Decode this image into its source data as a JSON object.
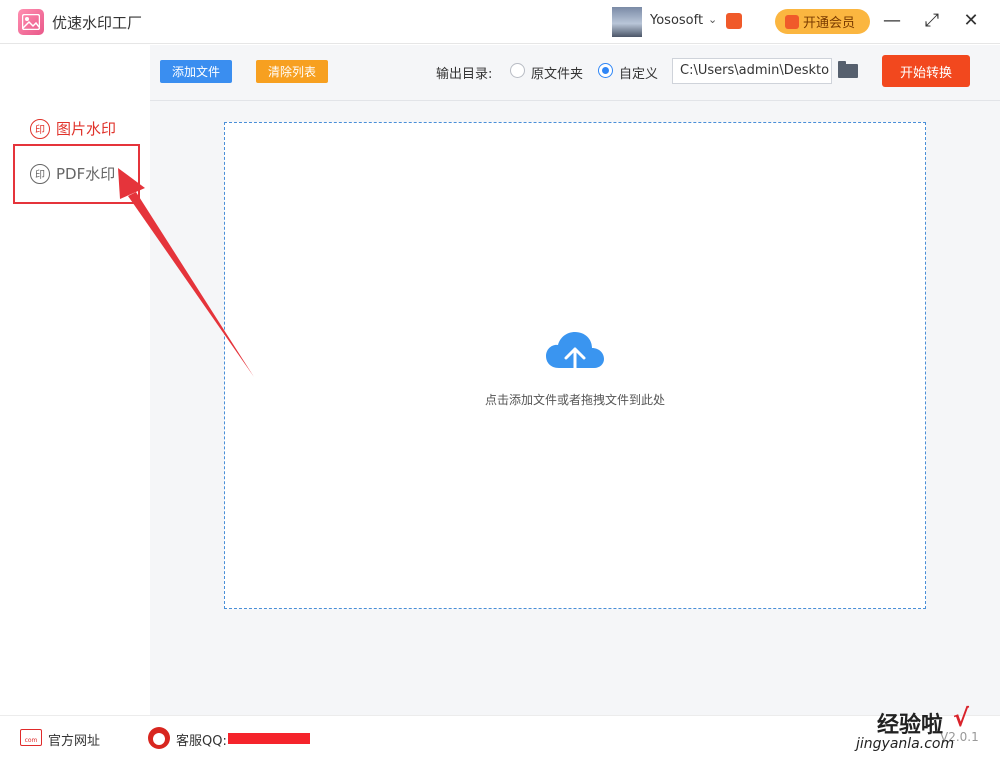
{
  "app": {
    "title": "优速水印工厂",
    "user": "Yososoft",
    "vip_label": "开通会员"
  },
  "window": {
    "minimize": "—",
    "maximize": "⤢",
    "close": "✕"
  },
  "sidebar": {
    "items": [
      {
        "label": "图片水印",
        "seal": "印",
        "active": true
      },
      {
        "label": "PDF水印",
        "seal": "印",
        "active": false
      }
    ]
  },
  "toolbar": {
    "add_label": "添加文件",
    "clear_label": "清除列表",
    "output_label": "输出目录:",
    "option_original": "原文件夹",
    "option_custom": "自定义",
    "selected_option": "自定义",
    "path_value": "C:\\Users\\admin\\Deskto",
    "start_label": "开始转换"
  },
  "dropzone": {
    "hint": "点击添加文件或者拖拽文件到此处"
  },
  "footer": {
    "site_label": "官方网址",
    "site_icon_text": "com",
    "support_label": "客服QQ:",
    "version": "V2.0.1"
  },
  "watermark": {
    "text": "经验啦",
    "url": "jingyanla.com",
    "check": "√"
  },
  "colors": {
    "accent_blue": "#3a8ef0",
    "orange": "#f7a020",
    "start_red": "#f2481e",
    "highlight_red": "#e5343b"
  }
}
